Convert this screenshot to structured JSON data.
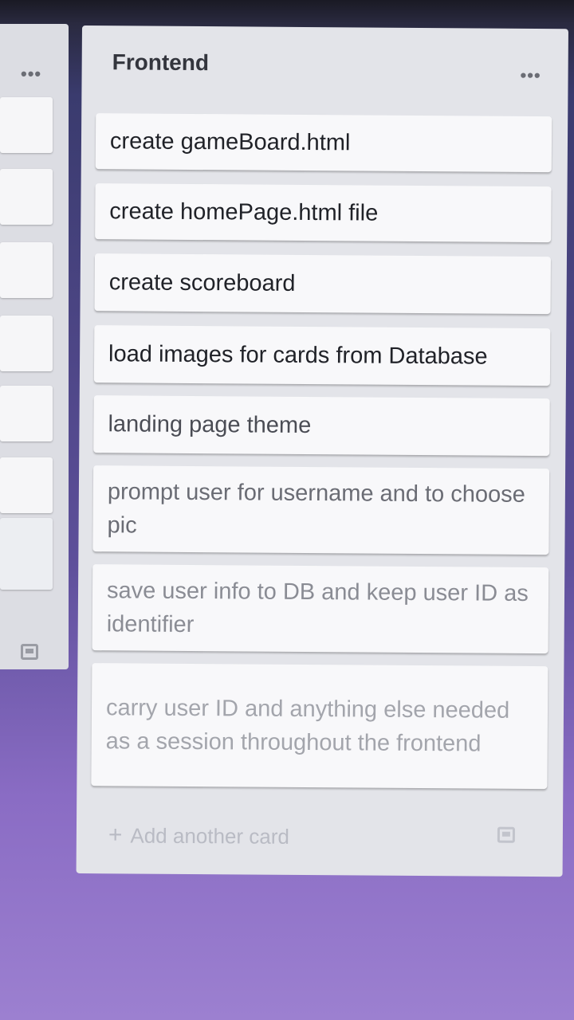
{
  "left_list": {
    "menu_icon": "ellipsis-icon",
    "template_icon": "card-template-icon"
  },
  "main_list": {
    "title": "Frontend",
    "menu_icon": "ellipsis-icon",
    "cards": [
      "create gameBoard.html",
      "create homePage.html file",
      "create scoreboard",
      "load images for cards from Database",
      "landing page theme",
      "prompt user for username and to choose pic",
      "save user info to DB and keep user ID as identifier",
      "carry user ID and anything else needed as a session throughout the frontend"
    ],
    "add_card_label": "Add another card",
    "add_card_icon": "plus-icon",
    "template_icon": "card-template-icon"
  }
}
